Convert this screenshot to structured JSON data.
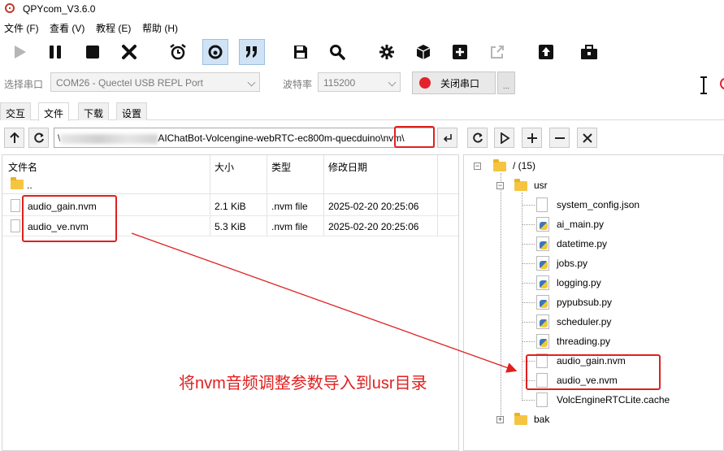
{
  "app": {
    "title": "QPYcom_V3.6.0"
  },
  "menu": [
    "文件 (F)",
    "查看 (V)",
    "教程 (E)",
    "帮助 (H)"
  ],
  "toolbar": {
    "buttons": [
      "play-icon",
      "pause-icon",
      "stop-icon",
      "close-icon",
      "alarm-clock-icon",
      "quote-open-icon",
      "quote-close-icon",
      "save-icon",
      "search-icon",
      "gear-icon",
      "cube-icon",
      "add-icon",
      "external-link-icon",
      "upload-icon",
      "toolbox-icon"
    ]
  },
  "port": {
    "port_label": "选择串口",
    "port_value": "COM26 - Quectel USB REPL Port",
    "baud_label": "波特率",
    "baud_value": "115200",
    "close_label": "关闭串口",
    "more_label": "..."
  },
  "tabs": [
    "交互",
    "文件",
    "下载",
    "设置"
  ],
  "path": {
    "prefix": "\\",
    "visible": "AIChatBot-Volcengine-webRTC-ec800m-quecduino",
    "highlighted": "\\nvm\\"
  },
  "local": {
    "columns": [
      "文件名",
      "大小",
      "类型",
      "修改日期"
    ],
    "parent": "..",
    "files": [
      {
        "name": "audio_gain.nvm",
        "size": "2.1 KiB",
        "type": ".nvm file",
        "date": "2025-02-20 20:25:06"
      },
      {
        "name": "audio_ve.nvm",
        "size": "5.3 KiB",
        "type": ".nvm file",
        "date": "2025-02-20 20:25:06"
      }
    ]
  },
  "tree": {
    "root": "/ (15)",
    "usr": "usr",
    "items": [
      {
        "name": "system_config.json",
        "kind": "file"
      },
      {
        "name": "ai_main.py",
        "kind": "py"
      },
      {
        "name": "datetime.py",
        "kind": "py"
      },
      {
        "name": "jobs.py",
        "kind": "py"
      },
      {
        "name": "logging.py",
        "kind": "py"
      },
      {
        "name": "pypubsub.py",
        "kind": "py"
      },
      {
        "name": "scheduler.py",
        "kind": "py"
      },
      {
        "name": "threading.py",
        "kind": "py"
      },
      {
        "name": "audio_gain.nvm",
        "kind": "file"
      },
      {
        "name": "audio_ve.nvm",
        "kind": "file"
      },
      {
        "name": "VolcEngineRTCLite.cache",
        "kind": "file"
      }
    ],
    "bak": "bak"
  },
  "annotation": {
    "text": "将nvm音频调整参数导入到usr目录",
    "color": "#e02020"
  }
}
